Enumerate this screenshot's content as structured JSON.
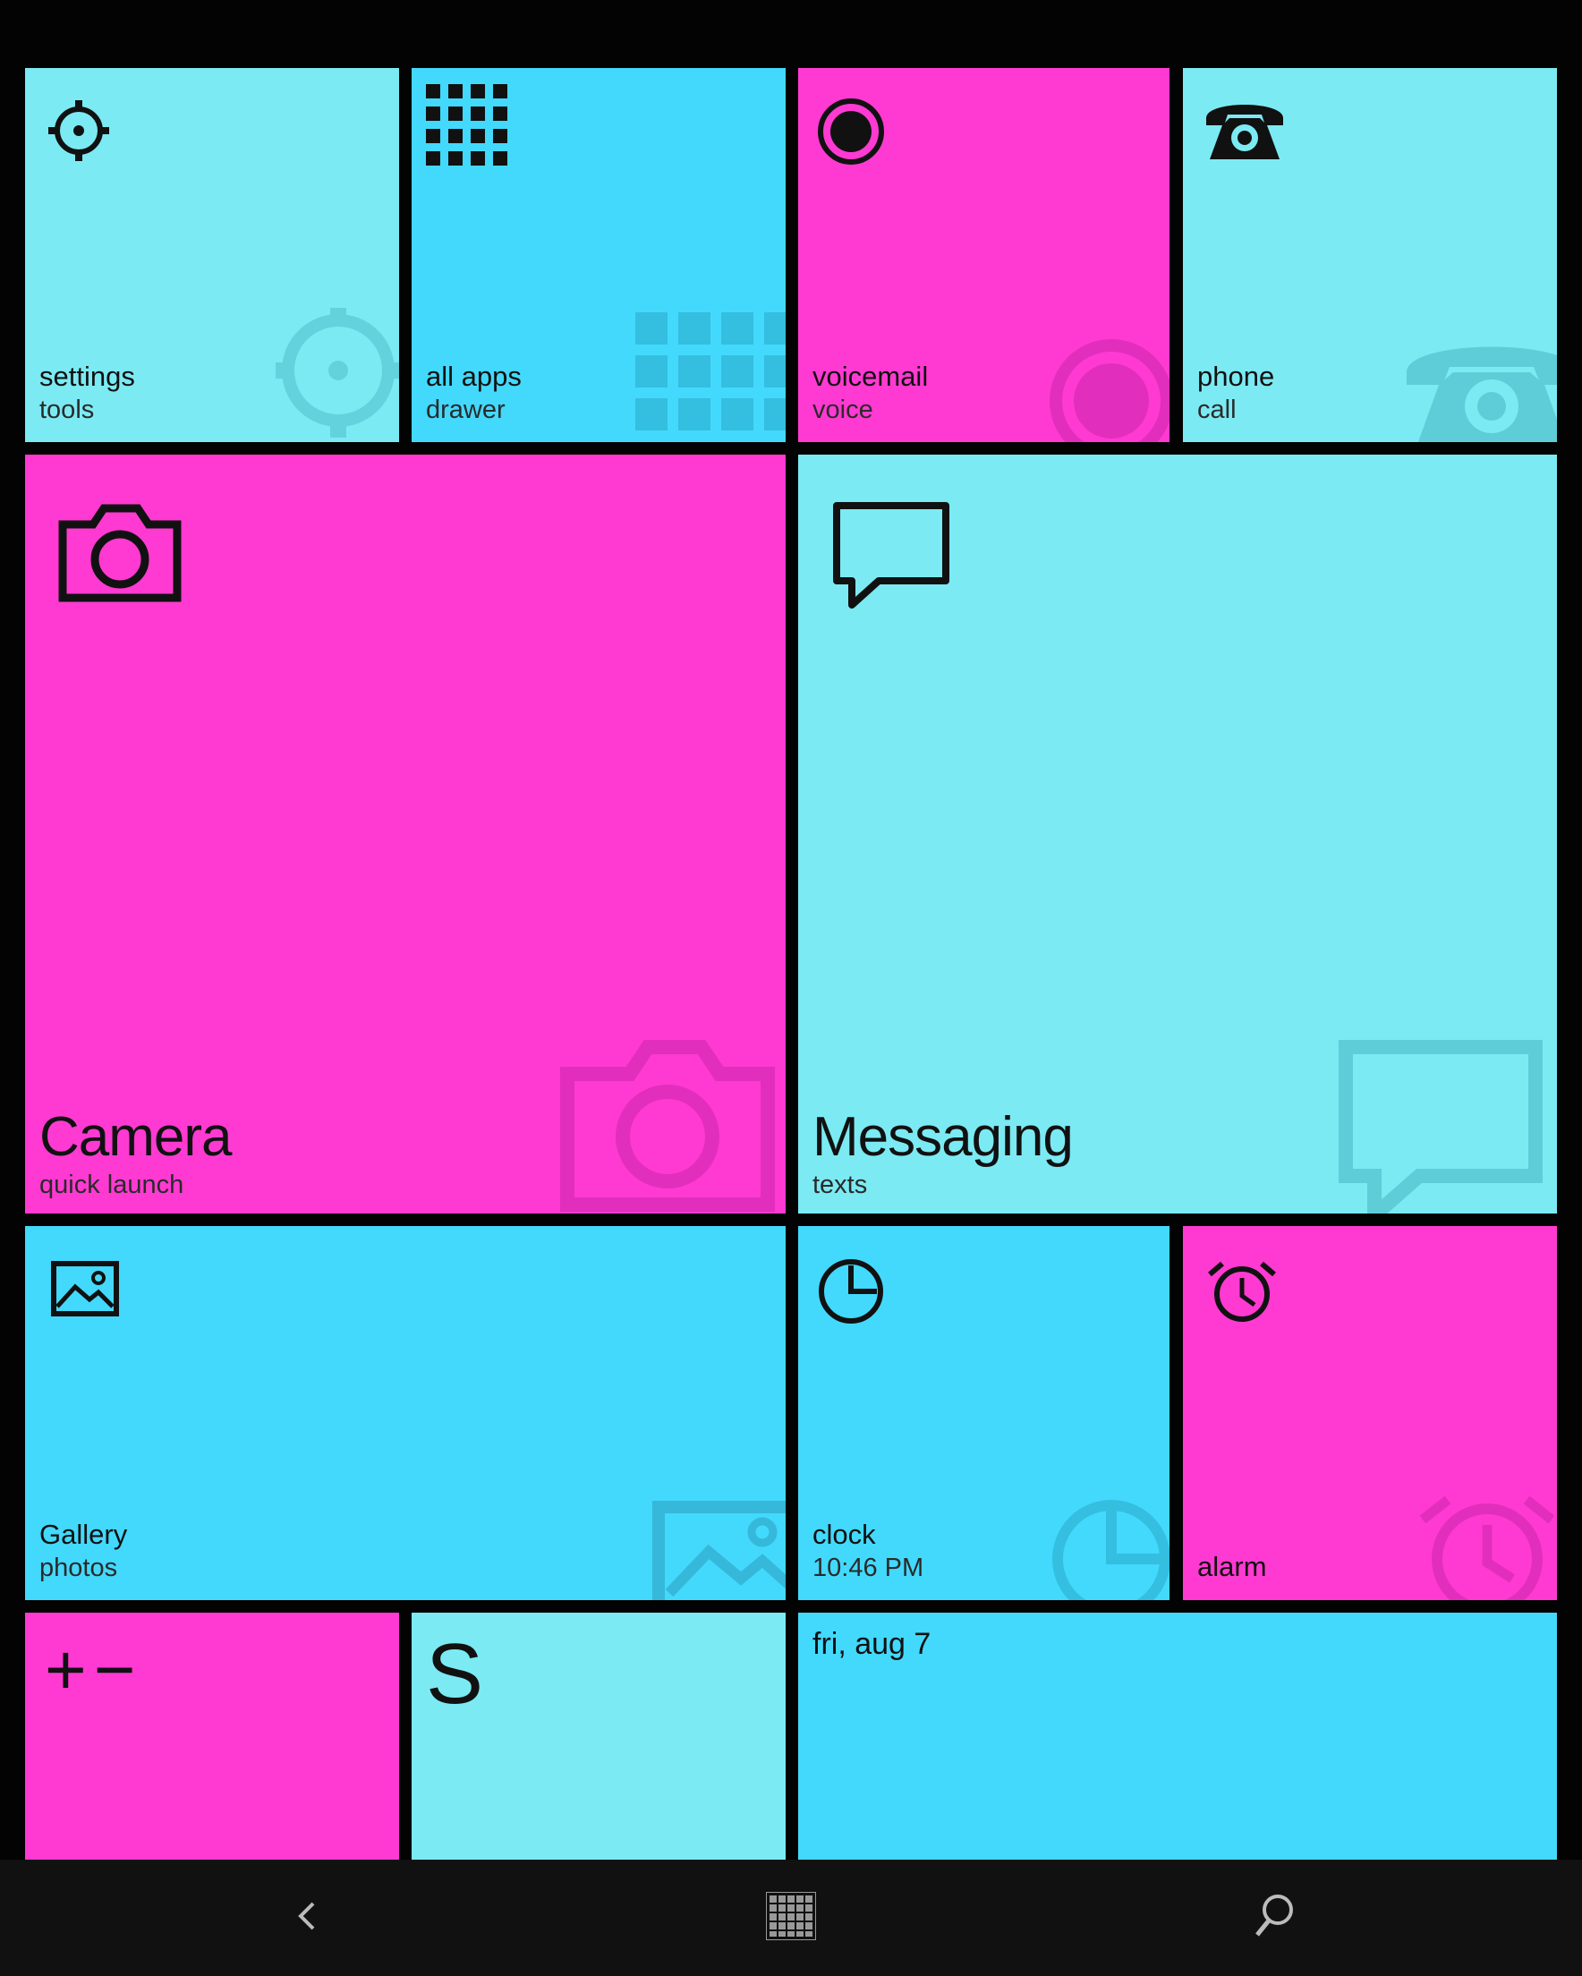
{
  "tiles": {
    "settings": {
      "title": "settings",
      "sub": "tools"
    },
    "apps": {
      "title": "all apps",
      "sub": "drawer"
    },
    "voicemail": {
      "title": "voicemail",
      "sub": "voice"
    },
    "phone": {
      "title": "phone",
      "sub": "call"
    },
    "camera": {
      "title": "Camera",
      "sub": "quick launch"
    },
    "messaging": {
      "title": "Messaging",
      "sub": "texts"
    },
    "gallery": {
      "title": "Gallery",
      "sub": "photos"
    },
    "clock": {
      "title": "clock",
      "sub": "10:46 PM"
    },
    "alarm": {
      "sub": "alarm"
    },
    "calculator": {
      "glyph": "+−"
    },
    "skype": {
      "glyph": "S"
    },
    "calendar": {
      "date": "fri, aug 7"
    }
  },
  "colors": {
    "cyan_light": "#7beaf3",
    "cyan": "#42d9fc",
    "pink": "#ff3ad2",
    "background": "#030303"
  },
  "nav": {
    "back_icon": "back-chevron-icon",
    "home_icon": "app-grid-icon",
    "search_icon": "search-icon"
  }
}
